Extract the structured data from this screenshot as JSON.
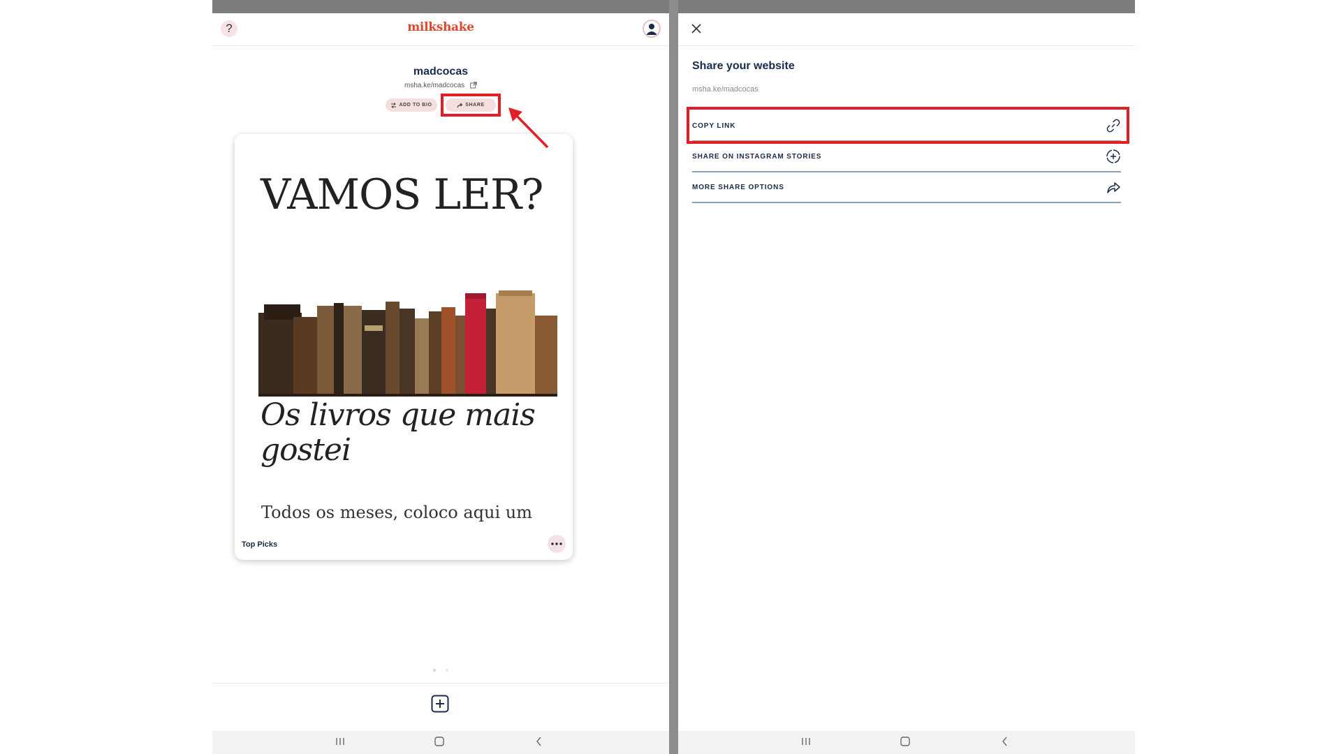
{
  "left": {
    "header": {
      "help_glyph": "?",
      "logo": "milkshake"
    },
    "profile": {
      "name": "madcocas",
      "url": "msha.ke/madcocas",
      "add_to_bio_label": "ADD TO BIO",
      "share_label": "SHARE"
    },
    "card": {
      "title": "VAMOS LER?",
      "subtitle": "Os livros que mais gostei",
      "text": "Todos os meses, coloco aqui um",
      "label": "Top Picks"
    }
  },
  "right": {
    "title": "Share your website",
    "url": "msha.ke/madcocas",
    "options": [
      {
        "label": "COPY LINK",
        "icon": "link-icon"
      },
      {
        "label": "SHARE ON INSTAGRAM STORIES",
        "icon": "add-story-icon"
      },
      {
        "label": "MORE SHARE OPTIONS",
        "icon": "share-arrow-icon"
      }
    ]
  },
  "colors": {
    "brand": "#e0452d",
    "text_navy": "#1a2b4a",
    "annotation_red": "#e01f26",
    "pill_pink": "#f5dede"
  }
}
